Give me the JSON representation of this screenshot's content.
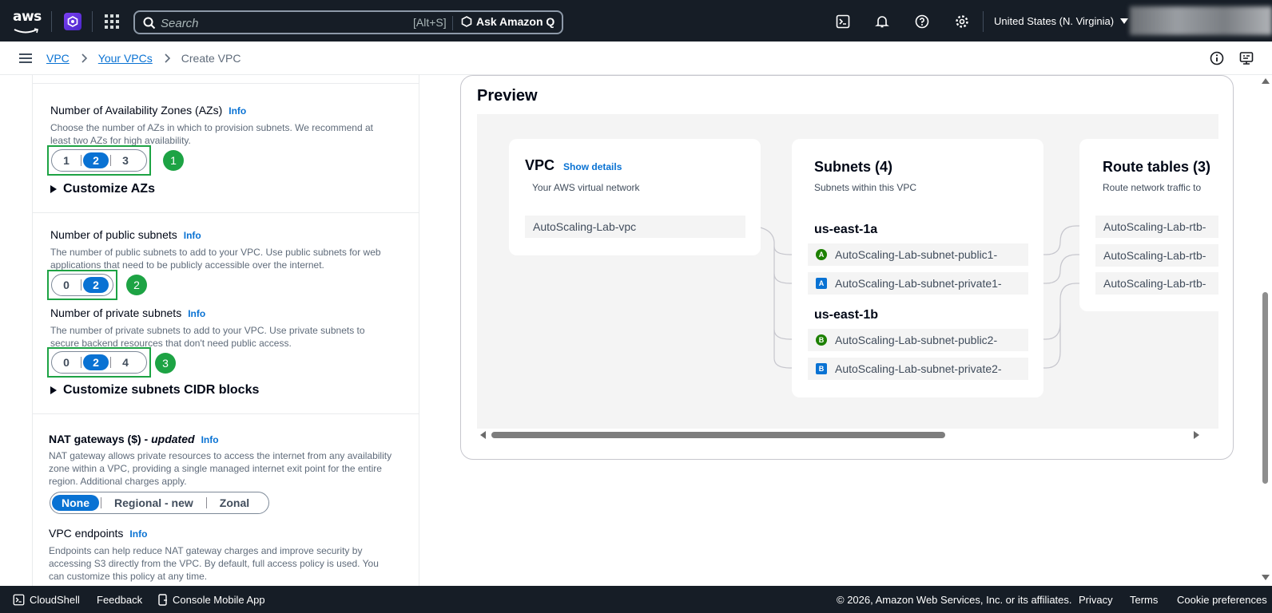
{
  "topnav": {
    "logo_text": "aws",
    "search_placeholder": "Search",
    "search_shortcut": "[Alt+S]",
    "ask_q": "Ask Amazon Q",
    "region": "United States (N. Virginia)"
  },
  "breadcrumb": {
    "items": [
      "VPC",
      "Your VPCs"
    ],
    "current": "Create VPC"
  },
  "left": {
    "azs": {
      "label": "Number of Availability Zones (AZs)",
      "info": "Info",
      "desc1": "Choose the number of AZs in which to provision subnets. We recommend at",
      "desc2": "least two AZs for high availability.",
      "options": [
        "1",
        "2",
        "3"
      ],
      "selected": "2",
      "badge": "1"
    },
    "customize_azs": "Customize AZs",
    "public": {
      "label": "Number of public subnets",
      "info": "Info",
      "desc1": "The number of public subnets to add to your VPC. Use public subnets for web",
      "desc2": "applications that need to be publicly accessible over the internet.",
      "options": [
        "0",
        "2"
      ],
      "selected": "2",
      "badge": "2"
    },
    "private": {
      "label": "Number of private subnets",
      "info": "Info",
      "desc1": "The number of private subnets to add to your VPC. Use private subnets to",
      "desc2": "secure backend resources that don't need public access.",
      "options": [
        "0",
        "2",
        "4"
      ],
      "selected": "2",
      "badge": "3"
    },
    "customize_cidr": "Customize subnets CIDR blocks",
    "nat": {
      "label": "NAT gateways ($) - ",
      "label_em": "updated",
      "info": "Info",
      "desc1": "NAT gateway allows private resources to access the internet from any availability",
      "desc2": "zone within a VPC, providing a single managed internet exit point for the entire",
      "desc3": "region. Additional charges apply.",
      "options": [
        "None",
        "Regional - new",
        "Zonal"
      ],
      "selected": "None"
    },
    "endpoints": {
      "label": "VPC endpoints",
      "info": "Info",
      "desc1": "Endpoints can help reduce NAT gateway charges and improve security by",
      "desc2": "accessing S3 directly from the VPC. By default, full access policy is used. You",
      "desc3": "can customize this policy at any time."
    }
  },
  "preview": {
    "title": "Preview",
    "vpc": {
      "title": "VPC",
      "show_details": "Show details",
      "sub": "Your AWS virtual network",
      "name": "AutoScaling-Lab-vpc"
    },
    "subnets": {
      "title": "Subnets (4)",
      "sub": "Subnets within this VPC",
      "az1": "us-east-1a",
      "az2": "us-east-1b",
      "items": [
        {
          "badge": "A",
          "kind": "pub",
          "name": "AutoScaling-Lab-subnet-public1-"
        },
        {
          "badge": "A",
          "kind": "priv",
          "name": "AutoScaling-Lab-subnet-private1-"
        },
        {
          "badge": "B",
          "kind": "pub",
          "name": "AutoScaling-Lab-subnet-public2-"
        },
        {
          "badge": "B",
          "kind": "priv",
          "name": "AutoScaling-Lab-subnet-private2-"
        }
      ]
    },
    "routes": {
      "title": "Route tables (3)",
      "sub": "Route network traffic to",
      "items": [
        "AutoScaling-Lab-rtb-",
        "AutoScaling-Lab-rtb-",
        "AutoScaling-Lab-rtb-"
      ]
    }
  },
  "footer": {
    "cloudshell": "CloudShell",
    "feedback": "Feedback",
    "mobile": "Console Mobile App",
    "copyright": "© 2026, Amazon Web Services, Inc. or its affiliates.",
    "privacy": "Privacy",
    "terms": "Terms",
    "cookies": "Cookie preferences"
  },
  "colors": {
    "nav_bg": "#161d26",
    "link": "#0972d3",
    "highlight": "#1da344",
    "selected": "#0972d3"
  }
}
